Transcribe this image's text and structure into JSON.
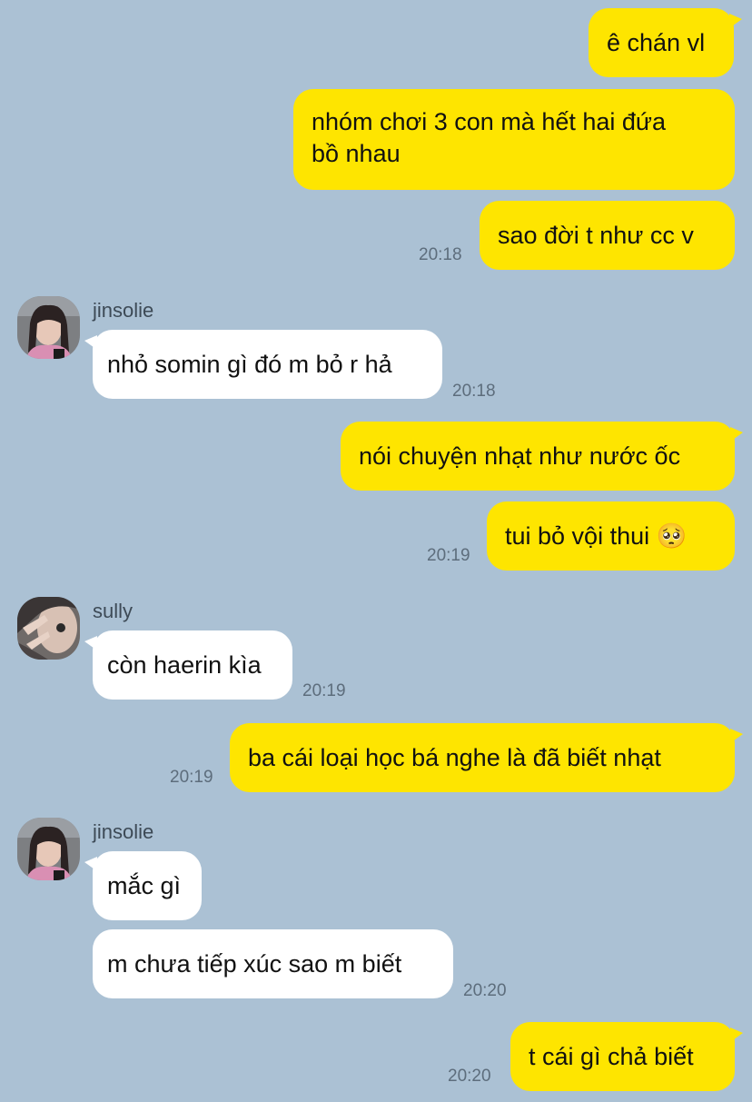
{
  "messages": [
    {
      "text": "ê chán vl"
    },
    {
      "text": "nhóm chơi 3 con mà hết hai đứa\nbồ nhau"
    },
    {
      "text": "sao đời t như cc v",
      "time": "20:18"
    },
    {
      "sender": "jinsolie",
      "text": "nhỏ somin gì đó m bỏ r hả",
      "time": "20:18"
    },
    {
      "text": "nói chuyện nhạt như nước ốc"
    },
    {
      "text": "tui bỏ vội thui 🥺",
      "time": "20:19"
    },
    {
      "sender": "sully",
      "text": "còn haerin kìa",
      "time": "20:19"
    },
    {
      "text": "ba cái loại học bá nghe là đã biết nhạt",
      "time": "20:19"
    },
    {
      "sender": "jinsolie",
      "text": "mắc gì"
    },
    {
      "text": "m chưa tiếp xúc sao m biết",
      "time": "20:20"
    },
    {
      "text": "t cái gì chả biết",
      "time": "20:20"
    }
  ],
  "colors": {
    "background": "#abc1d4",
    "outgoing": "#fee500",
    "incoming": "#ffffff"
  }
}
